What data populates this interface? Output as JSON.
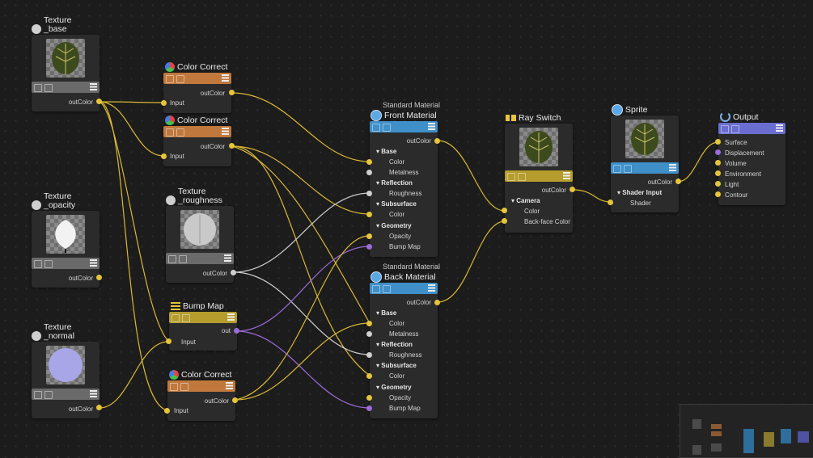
{
  "colors": {
    "wire_color": "#d9b834",
    "wire_vector": "#9b6bd8",
    "wire_value": "#cfcfcf",
    "bar_texture": "#6a6a6a",
    "bar_color_correct": "#c0783c",
    "bar_material": "#3f8fc9",
    "bar_ray_switch": "#b59c2d",
    "bar_sprite": "#3f8fc9",
    "bar_bump": "#b59c2d",
    "bar_output": "#6a6ed0"
  },
  "texture_base": {
    "sub": "Texture",
    "title": "_base",
    "out": "outColor",
    "icon": "texture-icon"
  },
  "texture_opacity": {
    "sub": "Texture",
    "title": "_opacity",
    "out": "outColor",
    "icon": "texture-icon"
  },
  "texture_normal": {
    "sub": "Texture",
    "title": "_normal",
    "out": "outColor",
    "icon": "texture-icon"
  },
  "texture_roughness": {
    "sub": "Texture",
    "title": "_roughness",
    "out": "outColor",
    "icon": "texture-icon"
  },
  "color_correct_1": {
    "title": "Color Correct",
    "out": "outColor",
    "input": "Input",
    "icon": "color-correct-icon"
  },
  "color_correct_2": {
    "title": "Color Correct",
    "out": "outColor",
    "input": "Input",
    "icon": "color-correct-icon"
  },
  "color_correct_3": {
    "title": "Color Correct",
    "out": "outColor",
    "input": "Input",
    "icon": "color-correct-icon"
  },
  "bump_map": {
    "title": "Bump Map",
    "out": "out",
    "input": "Input",
    "icon": "bump-map-icon"
  },
  "front_material": {
    "sub": "Standard Material",
    "title": "Front Material",
    "out": "outColor",
    "base": "Base",
    "color": "Color",
    "metalness": "Metalness",
    "reflection": "Reflection",
    "roughness": "Roughness",
    "subsurface": "Subsurface",
    "sub_color": "Color",
    "geometry": "Geometry",
    "opacity": "Opacity",
    "bump": "Bump Map",
    "icon": "material-icon"
  },
  "back_material": {
    "sub": "Standard Material",
    "title": "Back Material",
    "out": "outColor",
    "base": "Base",
    "color": "Color",
    "metalness": "Metalness",
    "reflection": "Reflection",
    "roughness": "Roughness",
    "subsurface": "Subsurface",
    "sub_color": "Color",
    "geometry": "Geometry",
    "opacity": "Opacity",
    "bump": "Bump Map",
    "icon": "material-icon"
  },
  "ray_switch": {
    "title": "Ray Switch",
    "out": "outColor",
    "camera": "Camera",
    "color": "Color",
    "backface": "Back-face Color",
    "icon": "ray-switch-icon"
  },
  "sprite": {
    "title": "Sprite",
    "out": "outColor",
    "shader_input": "Shader Input",
    "shader": "Shader",
    "icon": "sprite-icon"
  },
  "output": {
    "title": "Output",
    "ports": [
      "Surface",
      "Displacement",
      "Volume",
      "Environment",
      "Light",
      "Contour"
    ],
    "icon": "output-icon"
  }
}
